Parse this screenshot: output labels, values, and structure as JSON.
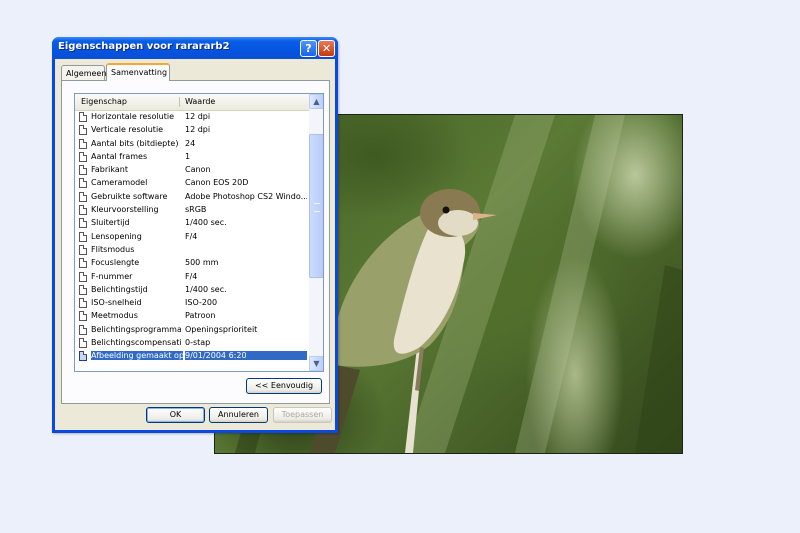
{
  "window": {
    "title": "Eigenschappen voor rarararb2",
    "help_glyph": "?",
    "close_glyph": "✕"
  },
  "tabs": [
    {
      "label": "Algemeen",
      "active": false
    },
    {
      "label": "Samenvatting",
      "active": true
    }
  ],
  "listview": {
    "col_property": "Eigenschap",
    "col_value": "Waarde",
    "rows": [
      {
        "key": "Horizontale resolutie",
        "value": "12 dpi"
      },
      {
        "key": "Verticale resolutie",
        "value": "12 dpi"
      },
      {
        "key": "Aantal bits (bitdiepte)",
        "value": "24"
      },
      {
        "key": "Aantal frames",
        "value": "1"
      },
      {
        "key": "Fabrikant",
        "value": "Canon"
      },
      {
        "key": "Cameramodel",
        "value": "Canon EOS 20D"
      },
      {
        "key": "Gebruikte software",
        "value": "Adobe Photoshop CS2 Windo..."
      },
      {
        "key": "Kleurvoorstelling",
        "value": "sRGB"
      },
      {
        "key": "Sluitertijd",
        "value": "1/400 sec."
      },
      {
        "key": "Lensopening",
        "value": "F/4"
      },
      {
        "key": "Flitsmodus",
        "value": ""
      },
      {
        "key": "Focuslengte",
        "value": "500 mm"
      },
      {
        "key": "F-nummer",
        "value": "F/4"
      },
      {
        "key": "Belichtingstijd",
        "value": "1/400 sec."
      },
      {
        "key": "ISO-snelheid",
        "value": "ISO-200"
      },
      {
        "key": "Meetmodus",
        "value": "Patroon"
      },
      {
        "key": "Belichtingsprogramma",
        "value": "Openingsprioriteit"
      },
      {
        "key": "Belichtingscompensatie",
        "value": "0-stap"
      },
      {
        "key": "Afbeelding gemaakt op",
        "value": "9/01/2004 6:20",
        "selected": true
      }
    ],
    "scroll_up_glyph": "▲",
    "scroll_down_glyph": "▼"
  },
  "buttons": {
    "simple": "<< Eenvoudig",
    "ok": "OK",
    "cancel": "Annuleren",
    "apply": "Toepassen"
  },
  "icons": {
    "row_icon": "document-icon",
    "help": "help-icon",
    "close": "close-icon"
  },
  "colors": {
    "titlebar": "#0454e0",
    "selection": "#316ac5",
    "dialog_face": "#ece9d8",
    "desktop": "#ecf0fb"
  }
}
